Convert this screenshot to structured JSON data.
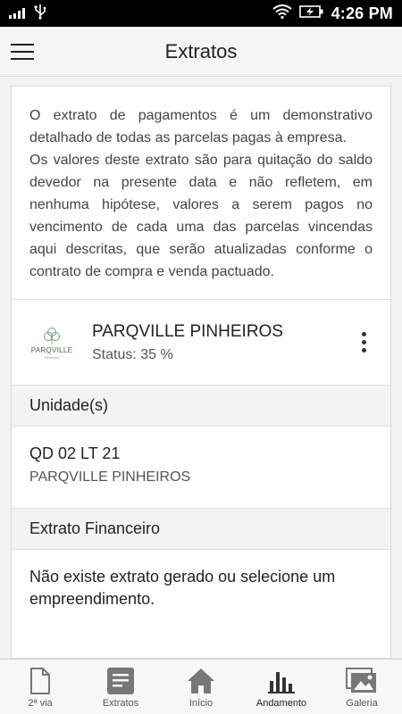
{
  "status_bar": {
    "time": "4:26 PM",
    "icons": [
      "signal-icon",
      "usb-icon",
      "wifi-icon",
      "battery-charging-icon"
    ]
  },
  "app_bar": {
    "title": "Extratos",
    "menu_icon": "hamburger-menu-icon"
  },
  "intro": {
    "paragraph_1": "O extrato de pagamentos é um demonstrativo detalhado de todas as parcelas pagas à empresa.",
    "paragraph_2": "Os valores deste extrato são para quitação do saldo devedor na presente data e não refletem, em nenhuma hipótese, valores a serem pagos no vencimento de cada uma das parcelas vincendas aqui descritas, que serão atualizadas conforme o contrato de compra e venda pactuado."
  },
  "project": {
    "logo_text": "PARQVILLE",
    "logo_subtext": "Pinheiros",
    "name": "PARQVILLE PINHEIROS",
    "status": "Status: 35 %",
    "progress_percent": 35,
    "more_icon": "more-vertical-icon"
  },
  "units_section": {
    "title": "Unidade(s)",
    "items": [
      {
        "code": "QD 02 LT 21",
        "project": "PARQVILLE PINHEIROS"
      }
    ]
  },
  "financial_section": {
    "title": "Extrato Financeiro",
    "message": "Não existe extrato gerado ou selecione um empreendimento."
  },
  "bottom_nav": {
    "items": [
      {
        "label": "2ª via",
        "icon": "document-icon"
      },
      {
        "label": "Extratos",
        "icon": "list-document-icon"
      },
      {
        "label": "Início",
        "icon": "home-icon"
      },
      {
        "label": "Andamento",
        "icon": "bar-chart-icon"
      },
      {
        "label": "Galeria",
        "icon": "gallery-icon"
      }
    ],
    "active_index": 3
  },
  "colors": {
    "status_bar_bg": "#000000",
    "app_bar_bg": "#f5f5f5",
    "section_header_bg": "#f3f3f3",
    "icon_gray": "#777777",
    "logo_green": "#7aa97a"
  }
}
